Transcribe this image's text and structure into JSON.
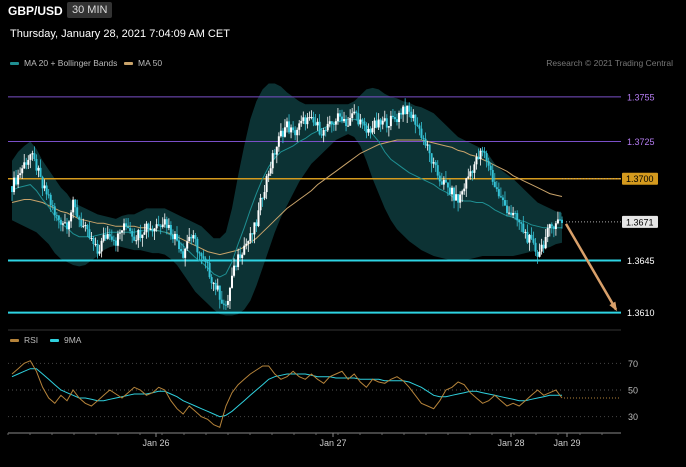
{
  "header": {
    "pair": "GBP/USD",
    "timeframe": "30 MIN",
    "timestamp": "Thursday, January 28, 2021 7:04:09 AM CET"
  },
  "legend": {
    "ma20": "MA 20 + Bollinger Bands",
    "ma50": "MA 50",
    "credit": "Research © 2021 Trading Central"
  },
  "rsi_legend": {
    "rsi": "RSI",
    "ma9": "9MA"
  },
  "colors": {
    "up": "#ffffff",
    "down": "#35c3d6",
    "ma20": "#1f8f92",
    "ma50": "#c9a36a",
    "band": "#0e3b3d",
    "rsi": "#b5833a",
    "rsi_ma": "#2fd0dd",
    "support": "#2ed4e3",
    "resistance": "#7a4fc8",
    "pivot": "#d49a1e",
    "arrow": "#d9a06a"
  },
  "chart_data": [
    {
      "type": "candlestick",
      "title": "GBP/USD",
      "timeframe": "30 MIN",
      "x_tick_labels": [
        "Jan 26",
        "Jan 27",
        "Jan 28",
        "Jan 29"
      ],
      "ylim": [
        1.3605,
        1.3765
      ],
      "last_price": "1.3671",
      "levels": [
        {
          "value": 1.3755,
          "label": "1.3755",
          "kind": "resistance"
        },
        {
          "value": 1.3725,
          "label": "1.3725",
          "kind": "resistance"
        },
        {
          "value": 1.37,
          "label": "1.3700",
          "kind": "pivot"
        },
        {
          "value": 1.3645,
          "label": "1.3645",
          "kind": "support"
        },
        {
          "value": 1.361,
          "label": "1.3610",
          "kind": "support"
        }
      ],
      "close_path": [
        1.3695,
        1.3702,
        1.371,
        1.3716,
        1.3708,
        1.3694,
        1.3688,
        1.3675,
        1.3672,
        1.367,
        1.3682,
        1.3673,
        1.3665,
        1.3658,
        1.365,
        1.366,
        1.3664,
        1.3658,
        1.3666,
        1.3669,
        1.3661,
        1.3664,
        1.3669,
        1.3666,
        1.3671,
        1.3672,
        1.3665,
        1.3659,
        1.365,
        1.3662,
        1.3657,
        1.3646,
        1.364,
        1.363,
        1.3622,
        1.3612,
        1.3633,
        1.3648,
        1.3655,
        1.366,
        1.367,
        1.369,
        1.3705,
        1.3718,
        1.373,
        1.3736,
        1.373,
        1.3735,
        1.374,
        1.3738,
        1.3735,
        1.3731,
        1.3735,
        1.374,
        1.3742,
        1.3736,
        1.3745,
        1.3738,
        1.3731,
        1.3735,
        1.3736,
        1.3738,
        1.3739,
        1.3741,
        1.3748,
        1.3744,
        1.3739,
        1.373,
        1.372,
        1.3708,
        1.37,
        1.3695,
        1.369,
        1.3685,
        1.3695,
        1.3705,
        1.3712,
        1.3718,
        1.371,
        1.3695,
        1.3686,
        1.368,
        1.3675,
        1.367,
        1.3663,
        1.3656,
        1.365,
        1.3657,
        1.3666,
        1.3672,
        1.3671
      ],
      "band_upper": [
        1.3712,
        1.3718,
        1.3722,
        1.3725,
        1.372,
        1.3712,
        1.3706,
        1.37,
        1.3694,
        1.369,
        1.3684,
        1.3682,
        1.368,
        1.3678,
        1.3676,
        1.3675,
        1.3674,
        1.3673,
        1.3675,
        1.3676,
        1.3676,
        1.3678,
        1.368,
        1.368,
        1.368,
        1.368,
        1.3678,
        1.3676,
        1.3674,
        1.3672,
        1.367,
        1.3668,
        1.3664,
        1.366,
        1.366,
        1.3664,
        1.368,
        1.3702,
        1.3722,
        1.374,
        1.3752,
        1.376,
        1.3764,
        1.3764,
        1.3762,
        1.3758,
        1.3755,
        1.3752,
        1.375,
        1.375,
        1.375,
        1.375,
        1.375,
        1.375,
        1.375,
        1.375,
        1.3752,
        1.3756,
        1.376,
        1.3761,
        1.376,
        1.3757,
        1.3755,
        1.3754,
        1.3752,
        1.3751,
        1.3749,
        1.3748,
        1.3746,
        1.3744,
        1.374,
        1.3736,
        1.3732,
        1.3728,
        1.3726,
        1.3724,
        1.3722,
        1.372,
        1.3716,
        1.371,
        1.3706,
        1.3703,
        1.37,
        1.3696,
        1.3692,
        1.3688,
        1.3684,
        1.3682,
        1.368,
        1.3678,
        1.3677
      ],
      "band_lower": [
        1.3672,
        1.367,
        1.3668,
        1.3666,
        1.3664,
        1.366,
        1.3656,
        1.365,
        1.3646,
        1.3644,
        1.3642,
        1.3641,
        1.3642,
        1.3645,
        1.3648,
        1.3652,
        1.3654,
        1.3655,
        1.3654,
        1.3653,
        1.3652,
        1.3652,
        1.3651,
        1.365,
        1.365,
        1.3649,
        1.3646,
        1.3642,
        1.3636,
        1.363,
        1.3624,
        1.362,
        1.3616,
        1.3612,
        1.3609,
        1.3608,
        1.3608,
        1.3609,
        1.3612,
        1.3618,
        1.3628,
        1.364,
        1.3652,
        1.3664,
        1.3674,
        1.3682,
        1.369,
        1.3698,
        1.3704,
        1.371,
        1.3714,
        1.3718,
        1.3722,
        1.3726,
        1.3728,
        1.373,
        1.3728,
        1.3722,
        1.3712,
        1.37,
        1.369,
        1.368,
        1.3672,
        1.3666,
        1.3662,
        1.3658,
        1.3655,
        1.3652,
        1.365,
        1.3648,
        1.3647,
        1.3646,
        1.3645,
        1.3645,
        1.3645,
        1.3646,
        1.3647,
        1.3648,
        1.3648,
        1.3648,
        1.3648,
        1.3648,
        1.3648,
        1.3649,
        1.365,
        1.3651,
        1.3652,
        1.3653,
        1.3654,
        1.3656,
        1.3657
      ],
      "ma20": [
        1.3692,
        1.3694,
        1.3695,
        1.3696,
        1.3692,
        1.3686,
        1.3681,
        1.3675,
        1.367,
        1.3667,
        1.3663,
        1.3661,
        1.3661,
        1.3661,
        1.3662,
        1.3663,
        1.3664,
        1.3664,
        1.3664,
        1.3664,
        1.3664,
        1.3665,
        1.3665,
        1.3665,
        1.3665,
        1.3664,
        1.3662,
        1.3659,
        1.3655,
        1.3651,
        1.3647,
        1.3644,
        1.364,
        1.3636,
        1.3634,
        1.3636,
        1.3644,
        1.3656,
        1.3667,
        1.3679,
        1.369,
        1.37,
        1.3708,
        1.3714,
        1.3718,
        1.372,
        1.3722,
        1.3725,
        1.3727,
        1.373,
        1.3732,
        1.3734,
        1.3736,
        1.3738,
        1.3739,
        1.374,
        1.374,
        1.3739,
        1.3736,
        1.373,
        1.3725,
        1.3718,
        1.3713,
        1.371,
        1.3707,
        1.3704,
        1.3702,
        1.37,
        1.3698,
        1.3696,
        1.3693,
        1.3691,
        1.3688,
        1.3686,
        1.3685,
        1.3685,
        1.3684,
        1.3684,
        1.3682,
        1.3679,
        1.3677,
        1.3675,
        1.3674,
        1.3672,
        1.3671,
        1.3669,
        1.3668,
        1.3667,
        1.3667,
        1.3667,
        1.3667
      ],
      "ma50": [
        1.3684,
        1.3685,
        1.3686,
        1.3686,
        1.3685,
        1.3684,
        1.3682,
        1.368,
        1.3678,
        1.3677,
        1.3675,
        1.3673,
        1.3672,
        1.3671,
        1.367,
        1.367,
        1.3669,
        1.3668,
        1.3668,
        1.3668,
        1.3668,
        1.3667,
        1.3667,
        1.3666,
        1.3665,
        1.3664,
        1.3663,
        1.3661,
        1.3659,
        1.3657,
        1.3655,
        1.3653,
        1.3651,
        1.365,
        1.3649,
        1.365,
        1.3651,
        1.3652,
        1.3654,
        1.3657,
        1.366,
        1.3664,
        1.3668,
        1.3672,
        1.3676,
        1.368,
        1.3683,
        1.3686,
        1.3689,
        1.3692,
        1.3696,
        1.3699,
        1.3702,
        1.3705,
        1.3708,
        1.3711,
        1.3714,
        1.3717,
        1.3719,
        1.3721,
        1.3723,
        1.3724,
        1.3725,
        1.3726,
        1.3726,
        1.3726,
        1.3726,
        1.3726,
        1.3725,
        1.3724,
        1.3723,
        1.3722,
        1.3721,
        1.3719,
        1.3718,
        1.3716,
        1.3715,
        1.3713,
        1.3711,
        1.3709,
        1.3707,
        1.3705,
        1.3702,
        1.37,
        1.3698,
        1.3696,
        1.3694,
        1.3692,
        1.369,
        1.3689,
        1.3688
      ],
      "projection": {
        "from": 1.3671,
        "to": 1.361
      }
    },
    {
      "type": "line",
      "title": "RSI",
      "ylim": [
        20,
        80
      ],
      "y_ticks": [
        30,
        50,
        70
      ],
      "series": [
        {
          "name": "RSI",
          "values": [
            62,
            66,
            70,
            72,
            64,
            52,
            44,
            40,
            46,
            42,
            50,
            44,
            40,
            38,
            42,
            46,
            50,
            47,
            44,
            48,
            52,
            50,
            46,
            48,
            52,
            50,
            42,
            36,
            32,
            38,
            34,
            30,
            28,
            24,
            22,
            38,
            48,
            54,
            58,
            62,
            65,
            68,
            68,
            62,
            58,
            60,
            64,
            60,
            58,
            62,
            58,
            55,
            60,
            62,
            64,
            58,
            62,
            56,
            52,
            58,
            56,
            55,
            58,
            60,
            57,
            52,
            46,
            40,
            38,
            36,
            42,
            50,
            52,
            56,
            54,
            48,
            44,
            40,
            42,
            46,
            42,
            38,
            40,
            38,
            42,
            46,
            50,
            46,
            48,
            50,
            44
          ]
        },
        {
          "name": "9MA",
          "values": [
            60,
            62,
            64,
            66,
            66,
            62,
            58,
            54,
            50,
            48,
            46,
            44,
            44,
            43,
            42,
            42,
            43,
            44,
            45,
            46,
            47,
            47,
            47,
            48,
            49,
            49,
            47,
            45,
            42,
            40,
            38,
            36,
            34,
            32,
            30,
            31,
            34,
            38,
            42,
            46,
            50,
            54,
            58,
            60,
            61,
            62,
            62,
            62,
            62,
            61,
            60,
            60,
            60,
            59,
            59,
            59,
            59,
            58,
            58,
            58,
            58,
            57,
            57,
            57,
            57,
            56,
            54,
            52,
            49,
            46,
            45,
            45,
            46,
            47,
            48,
            49,
            49,
            48,
            47,
            46,
            45,
            44,
            43,
            42,
            42,
            43,
            44,
            45,
            46,
            46,
            46
          ]
        }
      ]
    }
  ]
}
